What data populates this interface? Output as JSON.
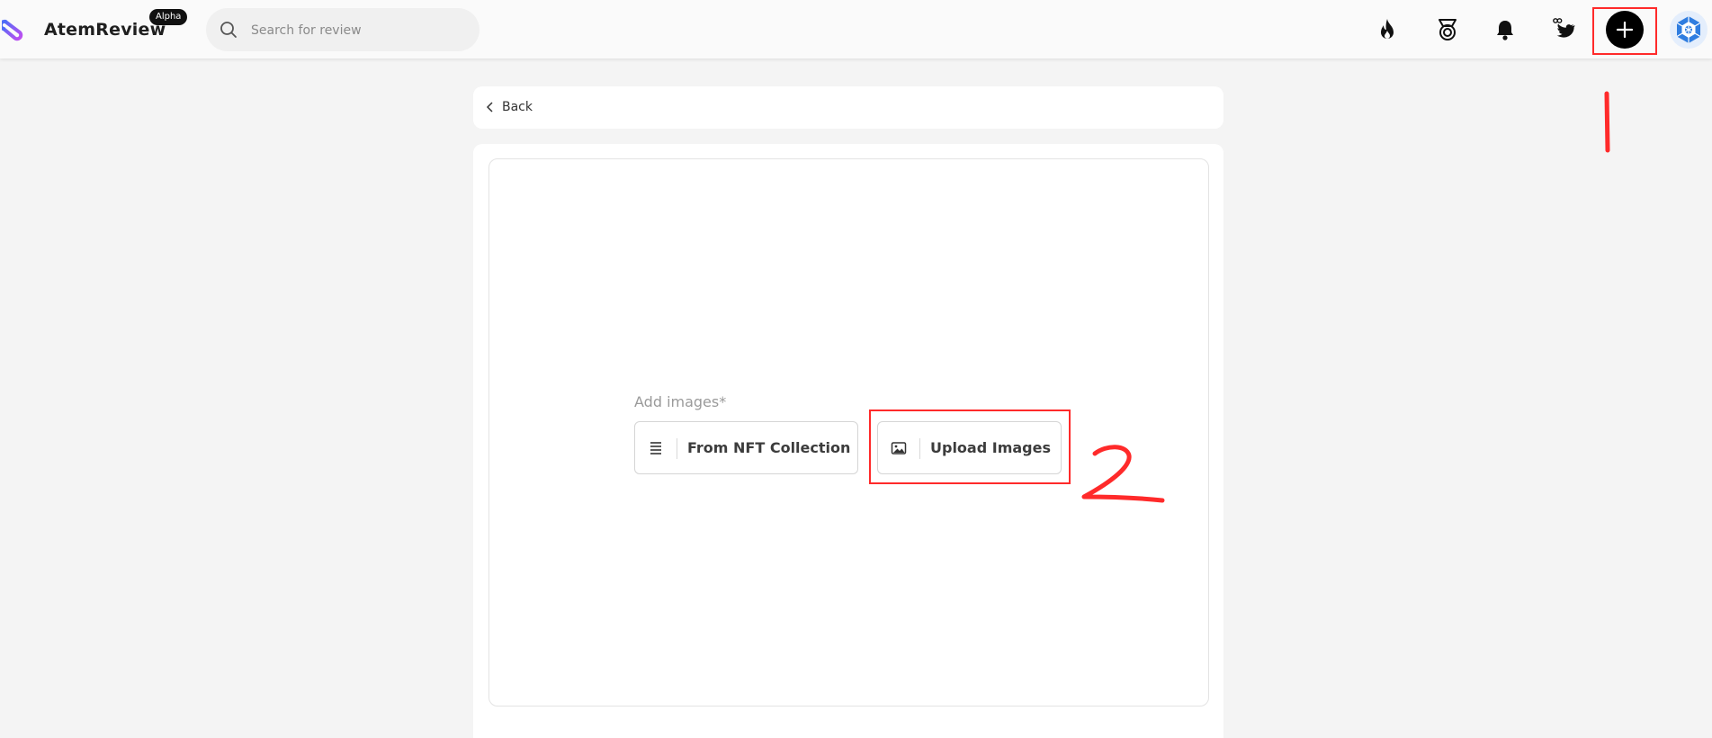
{
  "header": {
    "brand": "AtemReview",
    "badge": "Alpha",
    "search_placeholder": "Search for review",
    "icons": [
      "flame-icon",
      "medal-icon",
      "bell-icon",
      "twitter-link-icon",
      "plus-icon",
      "avatar"
    ]
  },
  "back": {
    "label": "Back"
  },
  "form": {
    "add_images_label": "Add images*",
    "nft_button_label": "From NFT Collection",
    "upload_button_label": "Upload Images"
  },
  "annotations": {
    "color": "#ff2a2a",
    "marks": [
      "1",
      "2"
    ]
  }
}
